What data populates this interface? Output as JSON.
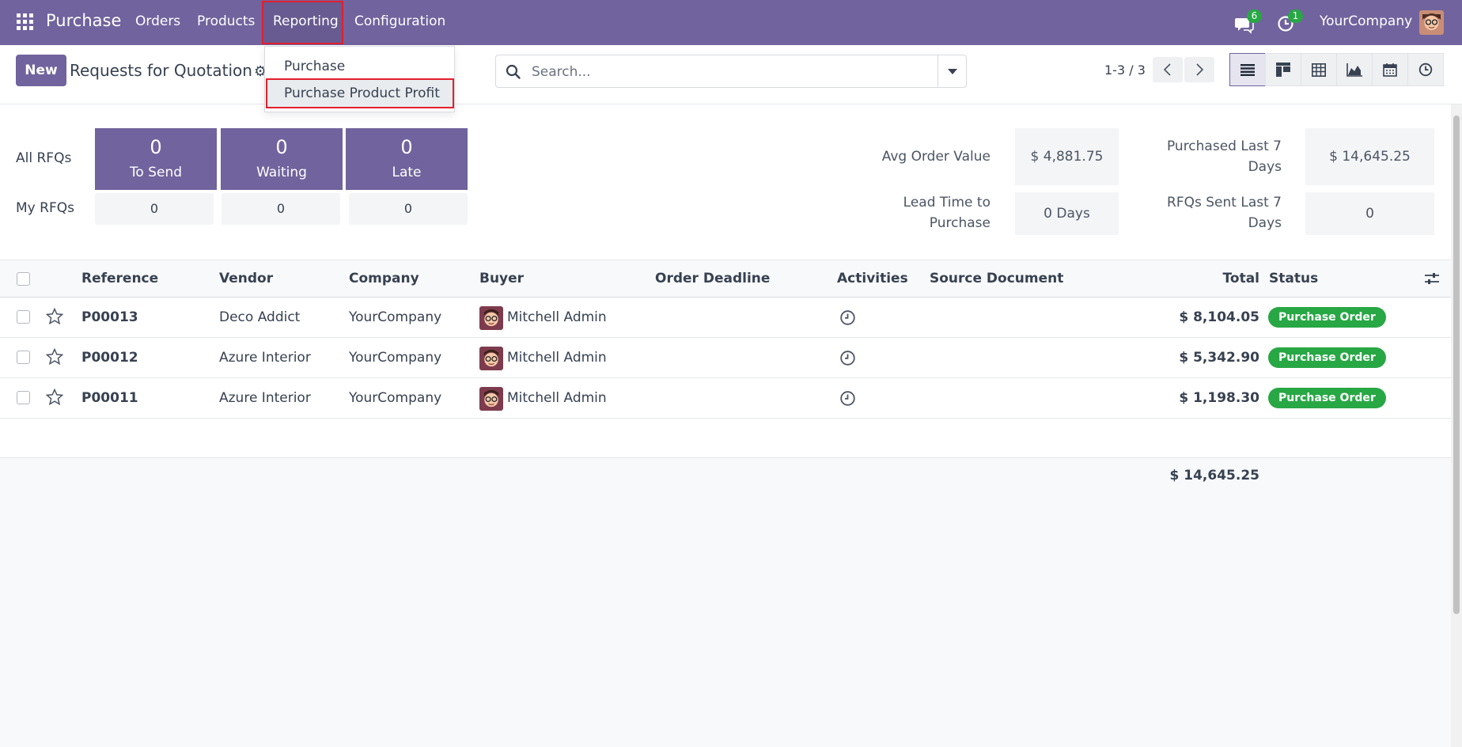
{
  "navbar": {
    "brand": "Purchase",
    "menu": [
      "Orders",
      "Products",
      "Reporting",
      "Configuration"
    ],
    "messages_count": "6",
    "activities_count": "1",
    "company": "YourCompany",
    "color": "#71639e"
  },
  "control_panel": {
    "new_label": "New",
    "title": "Requests for Quotation",
    "search_placeholder": "Search...",
    "pager": "1-3 / 3",
    "views": [
      "list-icon",
      "kanban-icon",
      "pivot-icon",
      "graph-icon",
      "calendar-icon",
      "activity-icon"
    ]
  },
  "reporting_dropdown": {
    "items": [
      "Purchase",
      "Purchase Product Profit"
    ]
  },
  "dashboard": {
    "all_rfqs_label": "All RFQs",
    "my_rfqs_label": "My RFQs",
    "cards": [
      {
        "value": "0",
        "label": "To Send"
      },
      {
        "value": "0",
        "label": "Waiting"
      },
      {
        "value": "0",
        "label": "Late"
      }
    ],
    "my_values": [
      "0",
      "0",
      "0"
    ],
    "kpis": {
      "avg_order_label": "Avg Order Value",
      "avg_order_value": "$ 4,881.75",
      "lead_time_label_1": "Lead Time to",
      "lead_time_label_2": "Purchase",
      "lead_time_value": "0 Days",
      "purchased_label_1": "Purchased Last 7",
      "purchased_label_2": "Days",
      "purchased_value": "$ 14,645.25",
      "rfqs_sent_label_1": "RFQs Sent Last 7",
      "rfqs_sent_label_2": "Days",
      "rfqs_sent_value": "0"
    }
  },
  "table": {
    "headers": {
      "reference": "Reference",
      "vendor": "Vendor",
      "company": "Company",
      "buyer": "Buyer",
      "deadline": "Order Deadline",
      "activities": "Activities",
      "source": "Source Document",
      "total": "Total",
      "status": "Status"
    },
    "rows": [
      {
        "reference": "P00013",
        "vendor": "Deco Addict",
        "company": "YourCompany",
        "buyer": "Mitchell Admin",
        "total": "$ 8,104.05",
        "status": "Purchase Order"
      },
      {
        "reference": "P00012",
        "vendor": "Azure Interior",
        "company": "YourCompany",
        "buyer": "Mitchell Admin",
        "total": "$ 5,342.90",
        "status": "Purchase Order"
      },
      {
        "reference": "P00011",
        "vendor": "Azure Interior",
        "company": "YourCompany",
        "buyer": "Mitchell Admin",
        "total": "$ 1,198.30",
        "status": "Purchase Order"
      }
    ],
    "grand_total": "$ 14,645.25",
    "status_color": "#28a745"
  }
}
